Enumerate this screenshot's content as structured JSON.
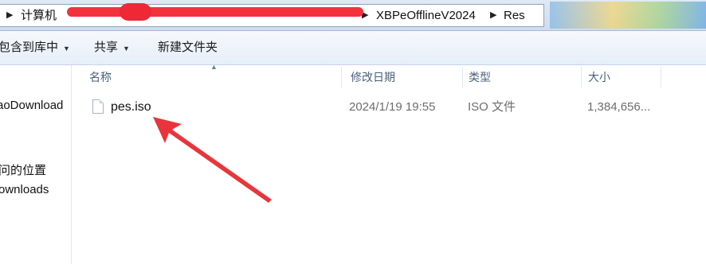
{
  "address_bar": {
    "root_label": "计算机",
    "crumbs": [
      "XBPeOfflineV2024",
      "Res"
    ],
    "redaction_color": "#f2323d"
  },
  "toolbar": {
    "include_library_label": "包含到库中",
    "share_label": "共享",
    "new_folder_label": "新建文件夹"
  },
  "nav_pane": {
    "items": [
      "aoDownload",
      "问的位置",
      "ownloads"
    ]
  },
  "file_list": {
    "columns": {
      "name": "名称",
      "modified": "修改日期",
      "type": "类型",
      "size": "大小"
    },
    "rows": [
      {
        "name": "pes.iso",
        "modified": "2024/1/19 19:55",
        "type": "ISO 文件",
        "size": "1,384,656..."
      }
    ]
  },
  "annotation": {
    "color": "#e8353c",
    "icon": "red-arrow-icon"
  }
}
